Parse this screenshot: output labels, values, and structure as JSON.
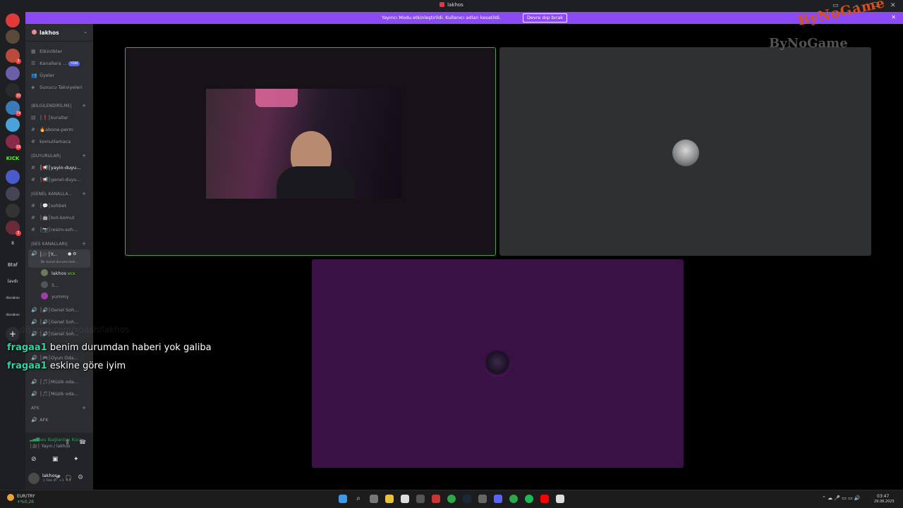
{
  "window": {
    "title": "lakhos"
  },
  "banner": {
    "message": "Yayıncı Modu etkinleştirildi. Kullanıcı adları kesatildi.",
    "button": "Devre dışı bırak"
  },
  "server": {
    "name": "lakhos",
    "menu_items": [
      {
        "label": "Etkinlikler",
        "icon": "calendar-icon"
      },
      {
        "label": "Kanallara ...",
        "icon": "channels-icon",
        "tag": "YENİ"
      },
      {
        "label": "Üyeler",
        "icon": "members-icon"
      },
      {
        "label": "Sunucu Takviyeleri",
        "icon": "boost-icon"
      }
    ]
  },
  "categories": [
    {
      "name": "|BİLGİLENDİRİLME|",
      "channels": [
        "│❗│kurallar",
        "🔥abone-perm",
        "komutlamaca"
      ]
    },
    {
      "name": "|DUYURULAR|",
      "channels": [
        "│📢│yayin-duyu...",
        "│📢│genel-duyu..."
      ]
    },
    {
      "name": "|GENEL KANALLA...",
      "channels": [
        "│💬│sohbet",
        "│🤖│bot-komut",
        "│📷│resim-soh..."
      ]
    },
    {
      "name": "|SES KANALLARI|",
      "channels": []
    }
  ],
  "voice": {
    "active_channel": "│🎥│Y...",
    "active_status": "Bir kanal durumu beli...",
    "users": [
      {
        "name": "lakhos",
        "tag": "KICK"
      },
      {
        "name": "S..."
      },
      {
        "name": "yummy"
      }
    ],
    "channels": [
      "│🔊│Genel Soh...",
      "│🔊│Genel Soh...",
      "│🔊│Genel Soh...",
      "│🎮│Oyun Oda...",
      "│🎵│Müzik oda...",
      "│🎵│Müzik oda..."
    ],
    "afk_category": "AFK",
    "afk_channel": "AFK"
  },
  "connection": {
    "status": "Ses Bağlantısı Kuru",
    "location": "│🎥│ Yayın / lakhos"
  },
  "user": {
    "name": "lakhos",
    "status": "♫ Fisk d... +1"
  },
  "guild_labels": [
    "KICK",
    "Btaf",
    "İavdı",
    "discobroo",
    "discobroo",
    "8"
  ],
  "guild_badges": [
    "3",
    "10",
    "18",
    "74",
    "80",
    "12",
    "3"
  ],
  "overlay": {
    "faded_text": "discorp.com/xoash/lakhos",
    "messages": [
      {
        "name": "fragaa1",
        "text": "benim durumdan haberi yok galiba"
      },
      {
        "name": "fragaa1",
        "text": "eskine göre iyim"
      }
    ]
  },
  "watermark": {
    "top": "ByNoGame",
    "bottom": "ByNoGame"
  },
  "taskbar": {
    "stock_name": "EUR/TRY",
    "stock_change": "+%0,26",
    "time": "03:47",
    "date": "29.08.2025"
  },
  "colors": {
    "accent": "#8c4af5",
    "speaking_outline": "#3ba55d",
    "tile_purple": "#3a1145",
    "tile_gray": "#2e3032",
    "overlay_name": "#2fd5a8"
  }
}
